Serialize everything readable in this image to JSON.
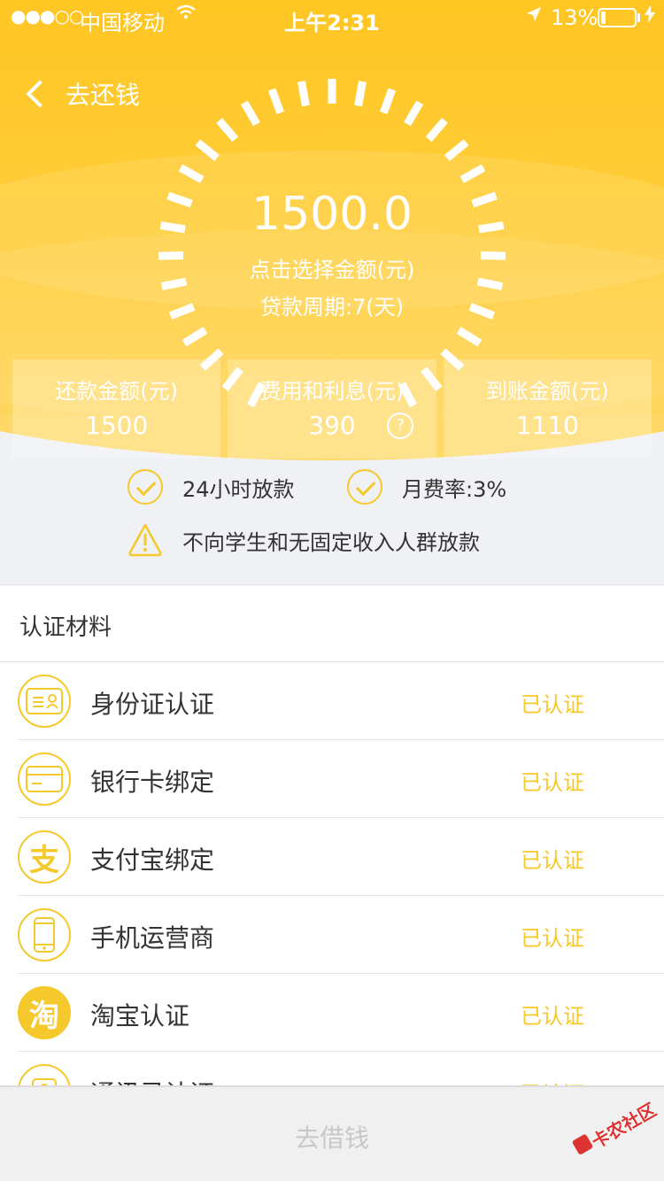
{
  "status_bar": {
    "signal": "●●●○○",
    "carrier": "中国移动",
    "time": "上午2:31",
    "battery_pct": "13%",
    "battery_level": 0.13
  },
  "nav": {
    "back_label": "去还钱"
  },
  "gauge": {
    "amount": "1500.0",
    "hint": "点击选择金额(元)",
    "period": "贷款周期:7(天)"
  },
  "summary": [
    {
      "label": "还款金额(元)",
      "value": "1500"
    },
    {
      "label": "费用和利息(元)",
      "value": "390",
      "help": "?"
    },
    {
      "label": "到账金额(元)",
      "value": "1110"
    }
  ],
  "features": {
    "fast_loan": "24小时放款",
    "monthly_rate": "月费率:3%",
    "warning": "不向学生和无固定收入人群放款"
  },
  "materials": {
    "title": "认证材料",
    "items": [
      {
        "label": "身份证认证",
        "status": "已认证",
        "icon": "id-card-icon"
      },
      {
        "label": "银行卡绑定",
        "status": "已认证",
        "icon": "bank-card-icon"
      },
      {
        "label": "支付宝绑定",
        "status": "已认证",
        "icon": "alipay-icon",
        "glyph": "支"
      },
      {
        "label": "手机运营商",
        "status": "已认证",
        "icon": "phone-icon"
      },
      {
        "label": "淘宝认证",
        "status": "已认证",
        "icon": "taobao-icon",
        "glyph": "淘"
      },
      {
        "label": "通讯录认证",
        "status": "已认证",
        "icon": "contacts-icon"
      }
    ]
  },
  "bottom_button": "去借钱",
  "watermark": "卡农社区",
  "colors": {
    "accent": "#ffc623",
    "status_text": "#f5c82b",
    "background_gray": "#eff1f4"
  }
}
